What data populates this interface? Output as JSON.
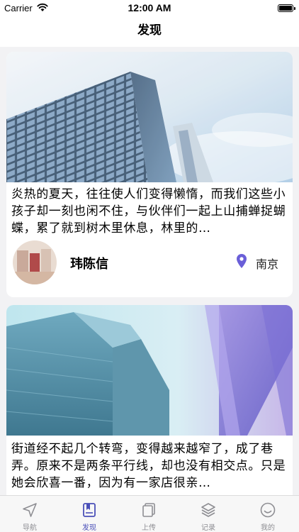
{
  "status_bar": {
    "carrier": "Carrier",
    "time": "12:00 AM"
  },
  "nav": {
    "title": "发现"
  },
  "feed": {
    "cards": [
      {
        "image": "skyscraper-blue-sky",
        "text": "炎热的夏天，往往使人们变得懒惰，而我们这些小孩子却一刻也闲不住，与伙伴们一起上山捕蝉捉蝴蝶，累了就到树木里休息，林里的…",
        "author": "玮陈信",
        "location": "南京"
      },
      {
        "image": "glass-towers-purple",
        "text": "街道经不起几个转弯，变得越来越窄了，成了巷弄。原来不是两条平行线，却也没有相交点。只是她会欣喜一番，因为有一家店很亲…"
      }
    ]
  },
  "tab_bar": {
    "tabs": [
      {
        "label": "导航",
        "icon": "navigation-arrow-icon",
        "active": false
      },
      {
        "label": "发现",
        "icon": "discover-book-icon",
        "active": true
      },
      {
        "label": "上传",
        "icon": "upload-cards-icon",
        "active": false
      },
      {
        "label": "记录",
        "icon": "layers-icon",
        "active": false
      },
      {
        "label": "我的",
        "icon": "smile-face-icon",
        "active": false
      }
    ]
  },
  "colors": {
    "accent": "#4a4fb8",
    "location_pin": "#6a5fd8",
    "inactive_tab": "#8e8e93",
    "background": "#f2f2f4"
  }
}
